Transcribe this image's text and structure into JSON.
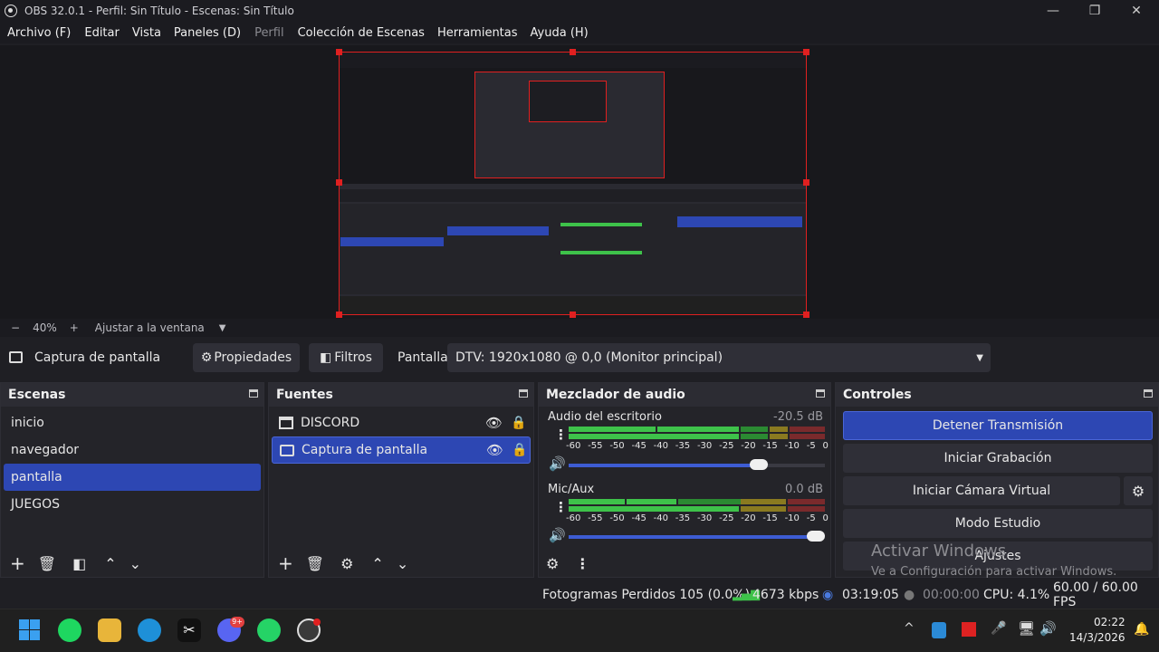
{
  "window": {
    "title": "OBS 32.0.1 - Perfil: Sin Título - Escenas: Sin Título",
    "minimize_icon": "—",
    "restore_icon": "❐",
    "close_icon": "✕"
  },
  "menu": {
    "items": [
      "Archivo (F)",
      "Editar",
      "Vista",
      "Paneles (D)",
      "Perfil",
      "Colección de Escenas",
      "Herramientas",
      "Ayuda (H)"
    ]
  },
  "zoom": {
    "minus": "−",
    "value": "40%",
    "plus": "+",
    "fit": "Ajustar a la ventana",
    "dropdown_icon": "▼"
  },
  "source_bar": {
    "source_name": "Captura de pantalla",
    "properties": "Propiedades",
    "filters": "Filtros",
    "display_label": "Pantalla",
    "display_value": "DTV: 1920x1080 @ 0,0 (Monitor principal)"
  },
  "scenes": {
    "title": "Escenas",
    "items": [
      "inicio",
      "navegador",
      "pantalla",
      "JUEGOS"
    ],
    "selected_index": 2
  },
  "sources": {
    "title": "Fuentes",
    "items": [
      "DISCORD",
      "Captura de pantalla"
    ],
    "selected_index": 1
  },
  "mixer": {
    "title": "Mezclador de audio",
    "channels": [
      {
        "name": "Audio del escritorio",
        "db": "-20.5 dB",
        "volume": 0.76
      },
      {
        "name": "Mic/Aux",
        "db": "0.0 dB",
        "volume": 1.0
      }
    ],
    "scale": [
      "-60",
      "-55",
      "-50",
      "-45",
      "-40",
      "-35",
      "-30",
      "-25",
      "-20",
      "-15",
      "-10",
      "-5",
      "0"
    ]
  },
  "controls": {
    "title": "Controles",
    "stop_stream": "Detener Transmisión",
    "start_record": "Iniciar Grabación",
    "start_vcam": "Iniciar Cámara Virtual",
    "studio_mode": "Modo Estudio",
    "settings": "Ajustes"
  },
  "activation": {
    "line1": "Activar Windows",
    "line2": "Ve a Configuración para activar Windows."
  },
  "status": {
    "dropped": "Fotogramas Perdidos 105 (0.0%)",
    "bitrate": "4673 kbps",
    "stream_time": "03:19:05",
    "record_time": "00:00:00",
    "cpu": "CPU: 4.1%",
    "fps": "60.00 / 60.00 FPS"
  },
  "taskbar": {
    "time": "02:22",
    "date": "14/3/2026",
    "discord_badge": "9+"
  },
  "colors": {
    "accent": "#2d47b3",
    "stop_stream_bg": "#2d47b3",
    "meter_green": "#3ec24a",
    "meter_yellow": "#b8a52a",
    "meter_red": "#c0383a",
    "selection_red": "#e02020"
  }
}
